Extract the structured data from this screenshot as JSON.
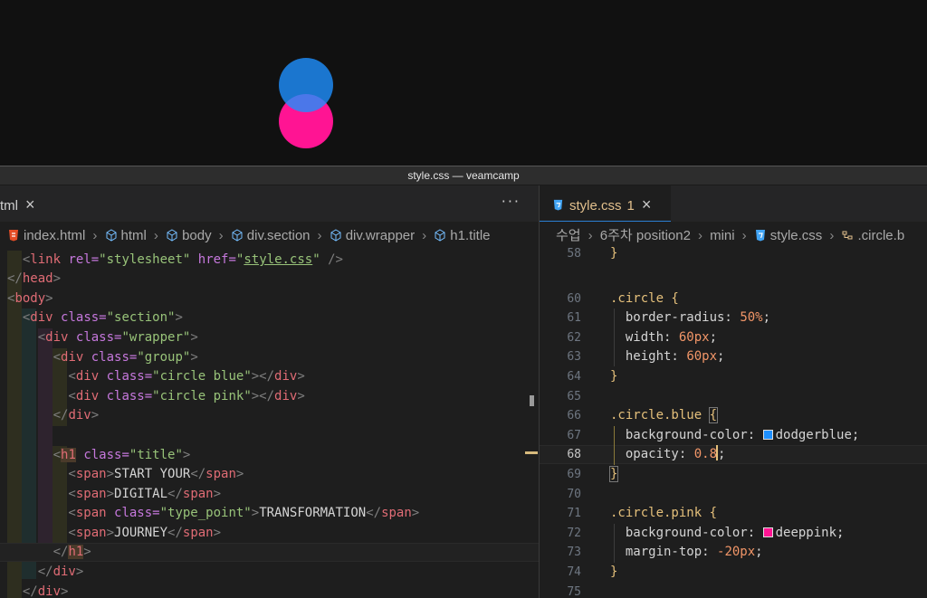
{
  "window": {
    "title": "style.css — veamcamp"
  },
  "preview": {
    "circle_blue_color": "#1e90ff",
    "circle_pink_color": "#ff1493",
    "circle_blue_opacity": 0.8
  },
  "left_editor": {
    "tab_label": "tml",
    "more_label": "···",
    "breadcrumb": [
      "index.html",
      "html",
      "body",
      "div.section",
      "div.wrapper",
      "h1.title"
    ]
  },
  "right_editor": {
    "tab_label": "style.css",
    "tab_modified": "1",
    "breadcrumb": [
      "수업",
      "6주차 position2",
      "mini",
      "style.css",
      ".circle.b"
    ]
  },
  "css_lines": [
    {
      "n": "58"
    },
    {
      "n": "60"
    },
    {
      "n": "61"
    },
    {
      "n": "62"
    },
    {
      "n": "63"
    },
    {
      "n": "64"
    },
    {
      "n": "65"
    },
    {
      "n": "66"
    },
    {
      "n": "67"
    },
    {
      "n": "68"
    },
    {
      "n": "69"
    },
    {
      "n": "70"
    },
    {
      "n": "71"
    },
    {
      "n": "72"
    },
    {
      "n": "73"
    },
    {
      "n": "74"
    },
    {
      "n": "75"
    }
  ],
  "css": {
    "close_brace": "}",
    "circle_sel": ".circle {",
    "br_prop": "border-radius:",
    "br_val": "50%",
    "w_prop": "width:",
    "w_val": "60px",
    "h_prop": "height:",
    "h_val": "60px",
    "blue_sel": ".circle.blue",
    "open_brace": "{",
    "bg_prop": "background-color:",
    "blue_val": "dodgerblue",
    "op_prop": "opacity:",
    "op_val": "0.8",
    "pink_sel": ".circle.pink {",
    "pink_val": "deeppink",
    "mt_prop": "margin-top:",
    "mt_val": "-20px",
    "semi": ";"
  },
  "html": {
    "link_tag": "link",
    "rel_attr": "rel=",
    "rel_val": "\"stylesheet\"",
    "href_attr": "href=",
    "href_val": "style.css",
    "head": "head",
    "body": "body",
    "div": "div",
    "h1": "h1",
    "span": "span",
    "class_attr": "class=",
    "section_val": "\"section\"",
    "wrapper_val": "\"wrapper\"",
    "group_val": "\"group\"",
    "blue_val": "\"circle blue\"",
    "pink_val": "\"circle pink\"",
    "title_val": "\"title\"",
    "type_point_val": "\"type_point\"",
    "t1": "START YOUR",
    "t2": "DIGITAL",
    "t3": "TRANSFORMATION",
    "t4": "JOURNEY"
  },
  "colors": {
    "accent": "#2b7fd4",
    "blue_swatch": "#1e90ff",
    "pink_swatch": "#ff1493"
  }
}
